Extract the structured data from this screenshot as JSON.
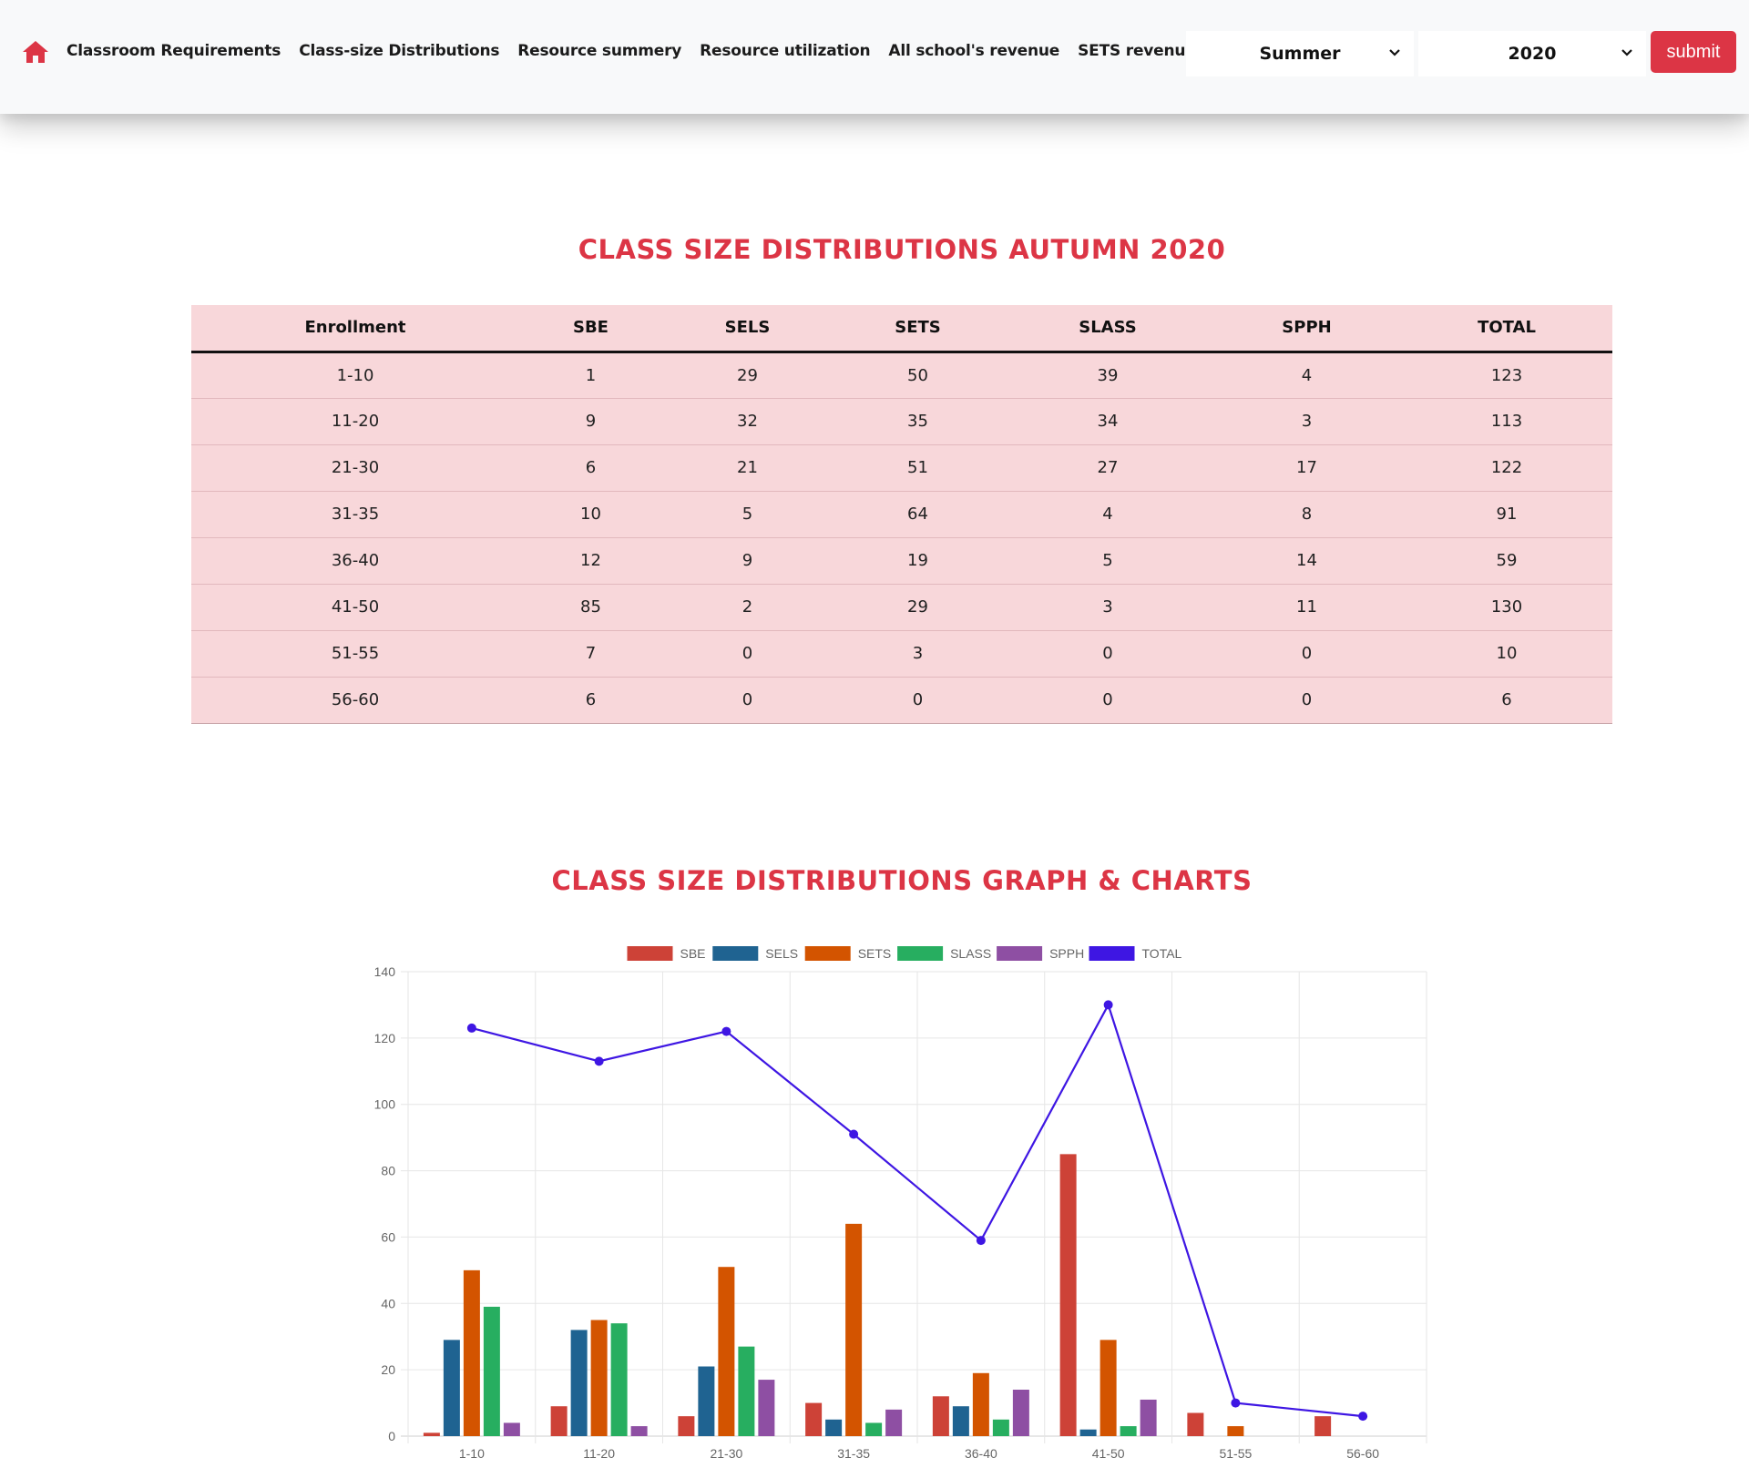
{
  "nav": {
    "links": [
      "Classroom Requirements",
      "Class-size Distributions",
      "Resource summery",
      "Resource utilization",
      "All school's revenue",
      "SETS revenue"
    ],
    "season": "Summer",
    "year": "2020",
    "submit_label": "submit",
    "accent_color": "#dc3545"
  },
  "table": {
    "title": "Class Size Distributions Autumn 2020",
    "headers": [
      "Enrollment",
      "SBE",
      "SELS",
      "SETS",
      "SLASS",
      "SPPH",
      "TOTAL"
    ],
    "rows": [
      [
        "1-10",
        "1",
        "29",
        "50",
        "39",
        "4",
        "123"
      ],
      [
        "11-20",
        "9",
        "32",
        "35",
        "34",
        "3",
        "113"
      ],
      [
        "21-30",
        "6",
        "21",
        "51",
        "27",
        "17",
        "122"
      ],
      [
        "31-35",
        "10",
        "5",
        "64",
        "4",
        "8",
        "91"
      ],
      [
        "36-40",
        "12",
        "9",
        "19",
        "5",
        "14",
        "59"
      ],
      [
        "41-50",
        "85",
        "2",
        "29",
        "3",
        "11",
        "130"
      ],
      [
        "51-55",
        "7",
        "0",
        "3",
        "0",
        "0",
        "10"
      ],
      [
        "56-60",
        "6",
        "0",
        "0",
        "0",
        "0",
        "6"
      ]
    ]
  },
  "chart_section": {
    "title": "Class Size Distributions Graph & Charts"
  },
  "chart_data": {
    "type": "bar",
    "categories": [
      "1-10",
      "11-20",
      "21-30",
      "31-35",
      "36-40",
      "41-50",
      "51-55",
      "56-60"
    ],
    "series": [
      {
        "name": "SBE",
        "type": "bar",
        "color": "#cd4237",
        "values": [
          1,
          9,
          6,
          10,
          12,
          85,
          7,
          6
        ]
      },
      {
        "name": "SELS",
        "type": "bar",
        "color": "#1f6391",
        "values": [
          29,
          32,
          21,
          5,
          9,
          2,
          0,
          0
        ]
      },
      {
        "name": "SETS",
        "type": "bar",
        "color": "#d35400",
        "values": [
          50,
          35,
          51,
          64,
          19,
          29,
          3,
          0
        ]
      },
      {
        "name": "SLASS",
        "type": "bar",
        "color": "#27ae60",
        "values": [
          39,
          34,
          27,
          4,
          5,
          3,
          0,
          0
        ]
      },
      {
        "name": "SPPH",
        "type": "bar",
        "color": "#8e4fa3",
        "values": [
          4,
          3,
          17,
          8,
          14,
          11,
          0,
          0
        ]
      },
      {
        "name": "TOTAL",
        "type": "line",
        "color": "#3e16e3",
        "values": [
          123,
          113,
          122,
          91,
          59,
          130,
          10,
          6
        ]
      }
    ],
    "ylim": [
      0,
      140
    ],
    "yticks": [
      0,
      20,
      40,
      60,
      80,
      100,
      120,
      140
    ],
    "grid": true,
    "legend": "top-center"
  }
}
